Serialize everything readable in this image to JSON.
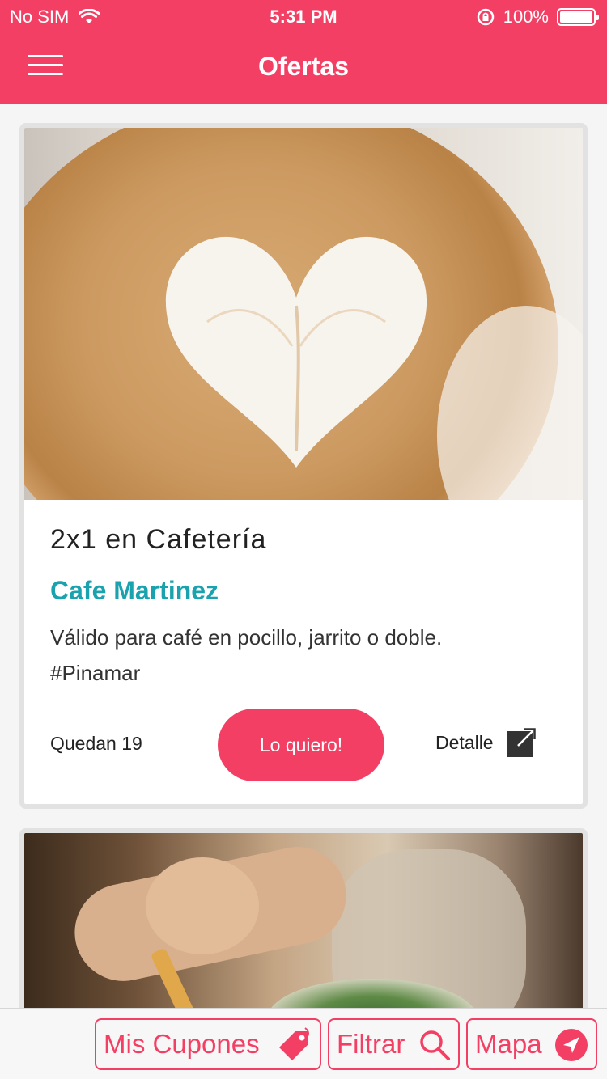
{
  "status_bar": {
    "carrier": "No SIM",
    "time": "5:31 PM",
    "battery": "100%",
    "icons": [
      "wifi-icon",
      "rotation-lock-icon",
      "battery-icon"
    ]
  },
  "nav": {
    "title": "Ofertas",
    "menu_icon": "hamburger-menu-icon"
  },
  "offers": [
    {
      "image": "coffee-latte-art",
      "title": "2x1 en Cafetería",
      "shop": "Cafe Martinez",
      "description": "Válido para café en pocillo, jarrito o doble.",
      "hashtag": "#Pinamar",
      "remaining": "Quedan 19",
      "cta": "Lo quiero!",
      "detail": "Detalle",
      "detail_icon": "external-link-icon"
    },
    {
      "image": "food-salad-hand"
    }
  ],
  "tabbar": {
    "coupons": "Mis Cupones",
    "filter": "Filtrar",
    "map": "Mapa",
    "icons": [
      "tag-icon",
      "search-icon",
      "navigation-arrow-icon"
    ]
  },
  "colors": {
    "brand": "#f43f65",
    "shop_name": "#1aa3ae"
  }
}
